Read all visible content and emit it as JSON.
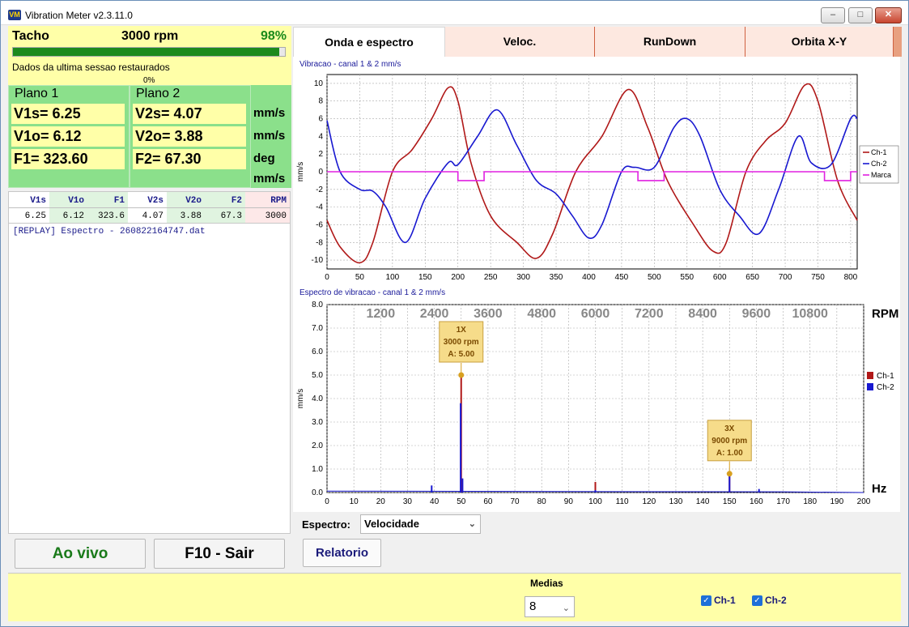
{
  "window": {
    "title": "Vibration Meter v2.3.11.0",
    "icon": "VM"
  },
  "tacho": {
    "label": "Tacho",
    "rpm": "3000 rpm",
    "percent": "98%",
    "progress": 0.98,
    "status": "Dados da ultima sessao restaurados",
    "sub_percent": "0%"
  },
  "plano1": {
    "title": "Plano 1",
    "v1s": "V1s= 6.25",
    "v1o": "V1o= 6.12",
    "f1": "F1= 323.60"
  },
  "plano2": {
    "title": "Plano 2",
    "v2s": "V2s= 4.07",
    "v2o": "V2o= 3.88",
    "f2": "F2= 67.30"
  },
  "units": {
    "u1": "mm/s",
    "u2": "mm/s",
    "u3": "deg",
    "u4": "mm/s"
  },
  "table": {
    "headers": [
      "V1s",
      "V1o",
      "F1",
      "V2s",
      "V2o",
      "F2",
      "RPM"
    ],
    "values": [
      "6.25",
      "6.12",
      "323.6",
      "4.07",
      "3.88",
      "67.3",
      "3000"
    ]
  },
  "log": {
    "line1": "[REPLAY] Espectro - 260822164747.dat"
  },
  "buttons": {
    "live": "Ao vivo",
    "exit": "F10 - Sair",
    "report": "Relatorio"
  },
  "tabs": [
    "Onda e espectro",
    "Veloc.",
    "RunDown",
    "Orbita X-Y"
  ],
  "spectrum_control": {
    "label": "Espectro:",
    "value": "Velocidade"
  },
  "medias": {
    "label": "Medias",
    "value": "8"
  },
  "channels": {
    "ch1": "Ch-1",
    "ch2": "Ch-2"
  },
  "colors": {
    "ch1": "#b01818",
    "ch2": "#1818d0",
    "marca": "#e020e0"
  },
  "chart_data": [
    {
      "type": "line",
      "title": "Vibracao  - canal 1 & 2 mm/s",
      "ylabel": "mm/s",
      "xlim": [
        0,
        810
      ],
      "ylim": [
        -11,
        11
      ],
      "xticks": [
        0,
        50,
        100,
        150,
        200,
        250,
        300,
        350,
        400,
        450,
        500,
        550,
        600,
        650,
        700,
        750,
        800
      ],
      "yticks": [
        -10,
        -8,
        -6,
        -4,
        -2,
        0,
        2,
        4,
        6,
        8,
        10
      ],
      "legend": [
        "Ch-1",
        "Ch-2",
        "Marca"
      ],
      "series": [
        {
          "name": "Ch-1",
          "x": [
            0,
            20,
            50,
            70,
            100,
            130,
            160,
            185,
            200,
            220,
            250,
            290,
            320,
            345,
            380,
            420,
            460,
            490,
            520,
            560,
            590,
            610,
            640,
            670,
            700,
            730,
            750,
            780,
            810
          ],
          "y": [
            -5.5,
            -8.5,
            -10.3,
            -8,
            0,
            2.5,
            6,
            9.5,
            8,
            1,
            -5,
            -8,
            -9.8,
            -7,
            0,
            4,
            9.3,
            5,
            -1,
            -6,
            -9,
            -8,
            0,
            3.5,
            5.5,
            9.8,
            8,
            -1,
            -5.5
          ]
        },
        {
          "name": "Ch-2",
          "x": [
            0,
            20,
            50,
            70,
            90,
            120,
            150,
            185,
            200,
            230,
            260,
            290,
            320,
            350,
            375,
            400,
            420,
            450,
            470,
            500,
            530,
            550,
            570,
            600,
            630,
            660,
            690,
            720,
            740,
            770,
            800,
            810
          ],
          "y": [
            5.8,
            0,
            -2,
            -2.2,
            -4,
            -8,
            -3,
            1,
            0.8,
            4,
            7,
            3,
            -1,
            -2.5,
            -5,
            -7.5,
            -6,
            0,
            0.5,
            0.5,
            5,
            6,
            4,
            -2,
            -5,
            -7,
            -2,
            4,
            1,
            0.8,
            6,
            6
          ]
        },
        {
          "name": "Marca",
          "x": [
            0,
            200,
            200,
            240,
            240,
            475,
            475,
            515,
            515,
            760,
            760,
            800,
            800,
            810
          ],
          "y": [
            0,
            0,
            -1,
            -1,
            0,
            0,
            -1,
            -1,
            0,
            0,
            -1,
            -1,
            0,
            0
          ]
        }
      ]
    },
    {
      "type": "line",
      "title": "Espectro de vibracao  - canal 1 & 2 mm/s",
      "ylabel": "mm/s",
      "xlabel": "Hz",
      "x2label": "RPM",
      "xlim": [
        0,
        200
      ],
      "ylim": [
        0,
        8
      ],
      "xticks": [
        0,
        10,
        20,
        30,
        40,
        50,
        60,
        70,
        80,
        90,
        100,
        110,
        120,
        130,
        140,
        150,
        160,
        170,
        180,
        190,
        200
      ],
      "yticks": [
        0.0,
        1.0,
        2.0,
        3.0,
        4.0,
        5.0,
        6.0,
        7.0,
        8.0
      ],
      "yticklabels": [
        "0.0",
        "1.0",
        "2.0",
        "3.0",
        "4.0",
        "5.0",
        "6.0",
        "7.0",
        "8.0"
      ],
      "rpm_ticks": [
        1200,
        2400,
        3600,
        4800,
        6000,
        7200,
        8400,
        9600,
        10800
      ],
      "legend": [
        "Ch-1",
        "Ch-2"
      ],
      "series": [
        {
          "name": "Ch-1",
          "peaks": [
            [
              50,
              5.0
            ],
            [
              100,
              0.45
            ],
            [
              150,
              0.8
            ]
          ]
        },
        {
          "name": "Ch-2",
          "peaks": [
            [
              39,
              0.3
            ],
            [
              49.8,
              3.8
            ],
            [
              50.5,
              0.6
            ],
            [
              100,
              0.1
            ],
            [
              150,
              0.9
            ],
            [
              161,
              0.15
            ]
          ]
        }
      ],
      "annotations": [
        {
          "line1": "1X",
          "line2": "3000 rpm",
          "line3": "A: 5.00",
          "x": 50,
          "y": 5.0
        },
        {
          "line1": "3X",
          "line2": "9000 rpm",
          "line3": "A: 1.00",
          "x": 150,
          "y": 0.8
        }
      ]
    }
  ]
}
